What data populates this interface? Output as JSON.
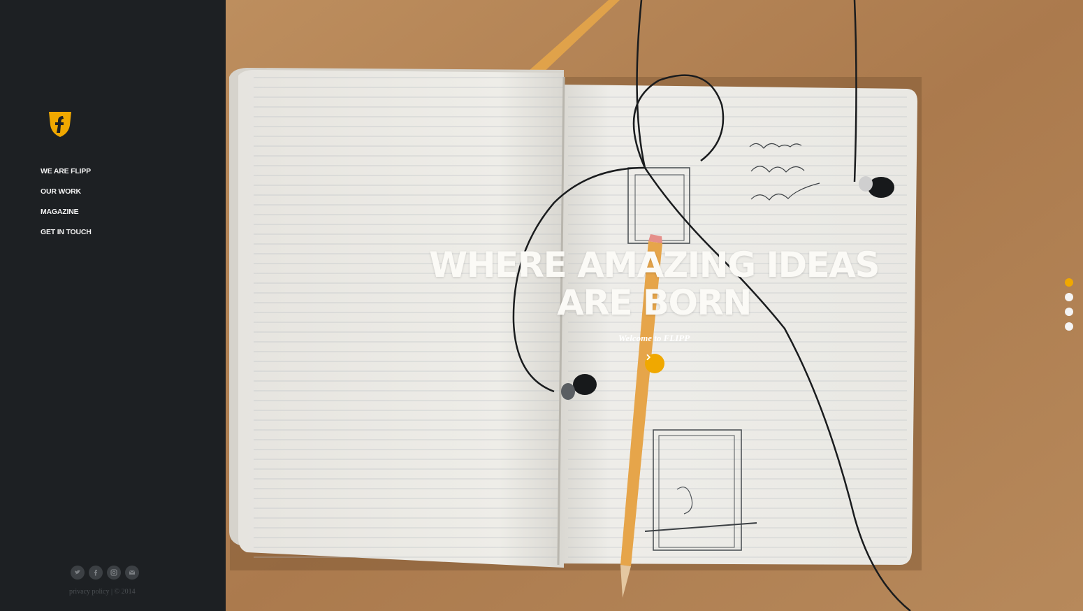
{
  "brand": {
    "logo_icon": "flipp-shield-logo",
    "accent_color": "#f0a800"
  },
  "nav": {
    "items": [
      {
        "label": "WE ARE FLIPP"
      },
      {
        "label": "OUR WORK"
      },
      {
        "label": "MAGAZINE"
      },
      {
        "label": "GET IN TOUCH"
      }
    ]
  },
  "social": {
    "icons": [
      "twitter-icon",
      "facebook-icon",
      "instagram-icon",
      "mail-icon"
    ]
  },
  "footer": {
    "privacy_label": "privacy policy",
    "separator": " | ",
    "copyright": "© 2014"
  },
  "hero": {
    "headline_line1": "WHERE AMAZING IDEAS",
    "headline_line2": "ARE BORN",
    "subtitle": "Welcome to FLIPP",
    "cta_icon": "chevron-right-icon"
  },
  "slider": {
    "count": 4,
    "active_index": 0
  }
}
